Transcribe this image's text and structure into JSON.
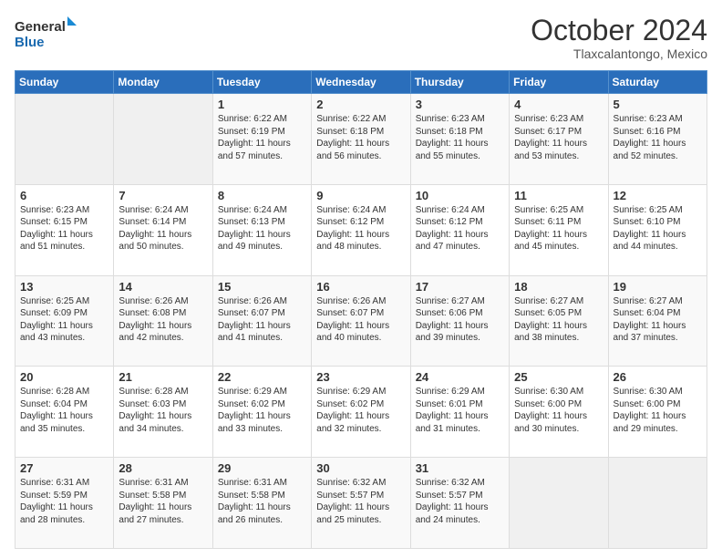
{
  "logo": {
    "line1": "General",
    "line2": "Blue"
  },
  "title": "October 2024",
  "subtitle": "Tlaxcalantongo, Mexico",
  "days_of_week": [
    "Sunday",
    "Monday",
    "Tuesday",
    "Wednesday",
    "Thursday",
    "Friday",
    "Saturday"
  ],
  "weeks": [
    [
      {
        "day": "",
        "text": ""
      },
      {
        "day": "",
        "text": ""
      },
      {
        "day": "1",
        "text": "Sunrise: 6:22 AM\nSunset: 6:19 PM\nDaylight: 11 hours and 57 minutes."
      },
      {
        "day": "2",
        "text": "Sunrise: 6:22 AM\nSunset: 6:18 PM\nDaylight: 11 hours and 56 minutes."
      },
      {
        "day": "3",
        "text": "Sunrise: 6:23 AM\nSunset: 6:18 PM\nDaylight: 11 hours and 55 minutes."
      },
      {
        "day": "4",
        "text": "Sunrise: 6:23 AM\nSunset: 6:17 PM\nDaylight: 11 hours and 53 minutes."
      },
      {
        "day": "5",
        "text": "Sunrise: 6:23 AM\nSunset: 6:16 PM\nDaylight: 11 hours and 52 minutes."
      }
    ],
    [
      {
        "day": "6",
        "text": "Sunrise: 6:23 AM\nSunset: 6:15 PM\nDaylight: 11 hours and 51 minutes."
      },
      {
        "day": "7",
        "text": "Sunrise: 6:24 AM\nSunset: 6:14 PM\nDaylight: 11 hours and 50 minutes."
      },
      {
        "day": "8",
        "text": "Sunrise: 6:24 AM\nSunset: 6:13 PM\nDaylight: 11 hours and 49 minutes."
      },
      {
        "day": "9",
        "text": "Sunrise: 6:24 AM\nSunset: 6:12 PM\nDaylight: 11 hours and 48 minutes."
      },
      {
        "day": "10",
        "text": "Sunrise: 6:24 AM\nSunset: 6:12 PM\nDaylight: 11 hours and 47 minutes."
      },
      {
        "day": "11",
        "text": "Sunrise: 6:25 AM\nSunset: 6:11 PM\nDaylight: 11 hours and 45 minutes."
      },
      {
        "day": "12",
        "text": "Sunrise: 6:25 AM\nSunset: 6:10 PM\nDaylight: 11 hours and 44 minutes."
      }
    ],
    [
      {
        "day": "13",
        "text": "Sunrise: 6:25 AM\nSunset: 6:09 PM\nDaylight: 11 hours and 43 minutes."
      },
      {
        "day": "14",
        "text": "Sunrise: 6:26 AM\nSunset: 6:08 PM\nDaylight: 11 hours and 42 minutes."
      },
      {
        "day": "15",
        "text": "Sunrise: 6:26 AM\nSunset: 6:07 PM\nDaylight: 11 hours and 41 minutes."
      },
      {
        "day": "16",
        "text": "Sunrise: 6:26 AM\nSunset: 6:07 PM\nDaylight: 11 hours and 40 minutes."
      },
      {
        "day": "17",
        "text": "Sunrise: 6:27 AM\nSunset: 6:06 PM\nDaylight: 11 hours and 39 minutes."
      },
      {
        "day": "18",
        "text": "Sunrise: 6:27 AM\nSunset: 6:05 PM\nDaylight: 11 hours and 38 minutes."
      },
      {
        "day": "19",
        "text": "Sunrise: 6:27 AM\nSunset: 6:04 PM\nDaylight: 11 hours and 37 minutes."
      }
    ],
    [
      {
        "day": "20",
        "text": "Sunrise: 6:28 AM\nSunset: 6:04 PM\nDaylight: 11 hours and 35 minutes."
      },
      {
        "day": "21",
        "text": "Sunrise: 6:28 AM\nSunset: 6:03 PM\nDaylight: 11 hours and 34 minutes."
      },
      {
        "day": "22",
        "text": "Sunrise: 6:29 AM\nSunset: 6:02 PM\nDaylight: 11 hours and 33 minutes."
      },
      {
        "day": "23",
        "text": "Sunrise: 6:29 AM\nSunset: 6:02 PM\nDaylight: 11 hours and 32 minutes."
      },
      {
        "day": "24",
        "text": "Sunrise: 6:29 AM\nSunset: 6:01 PM\nDaylight: 11 hours and 31 minutes."
      },
      {
        "day": "25",
        "text": "Sunrise: 6:30 AM\nSunset: 6:00 PM\nDaylight: 11 hours and 30 minutes."
      },
      {
        "day": "26",
        "text": "Sunrise: 6:30 AM\nSunset: 6:00 PM\nDaylight: 11 hours and 29 minutes."
      }
    ],
    [
      {
        "day": "27",
        "text": "Sunrise: 6:31 AM\nSunset: 5:59 PM\nDaylight: 11 hours and 28 minutes."
      },
      {
        "day": "28",
        "text": "Sunrise: 6:31 AM\nSunset: 5:58 PM\nDaylight: 11 hours and 27 minutes."
      },
      {
        "day": "29",
        "text": "Sunrise: 6:31 AM\nSunset: 5:58 PM\nDaylight: 11 hours and 26 minutes."
      },
      {
        "day": "30",
        "text": "Sunrise: 6:32 AM\nSunset: 5:57 PM\nDaylight: 11 hours and 25 minutes."
      },
      {
        "day": "31",
        "text": "Sunrise: 6:32 AM\nSunset: 5:57 PM\nDaylight: 11 hours and 24 minutes."
      },
      {
        "day": "",
        "text": ""
      },
      {
        "day": "",
        "text": ""
      }
    ]
  ]
}
